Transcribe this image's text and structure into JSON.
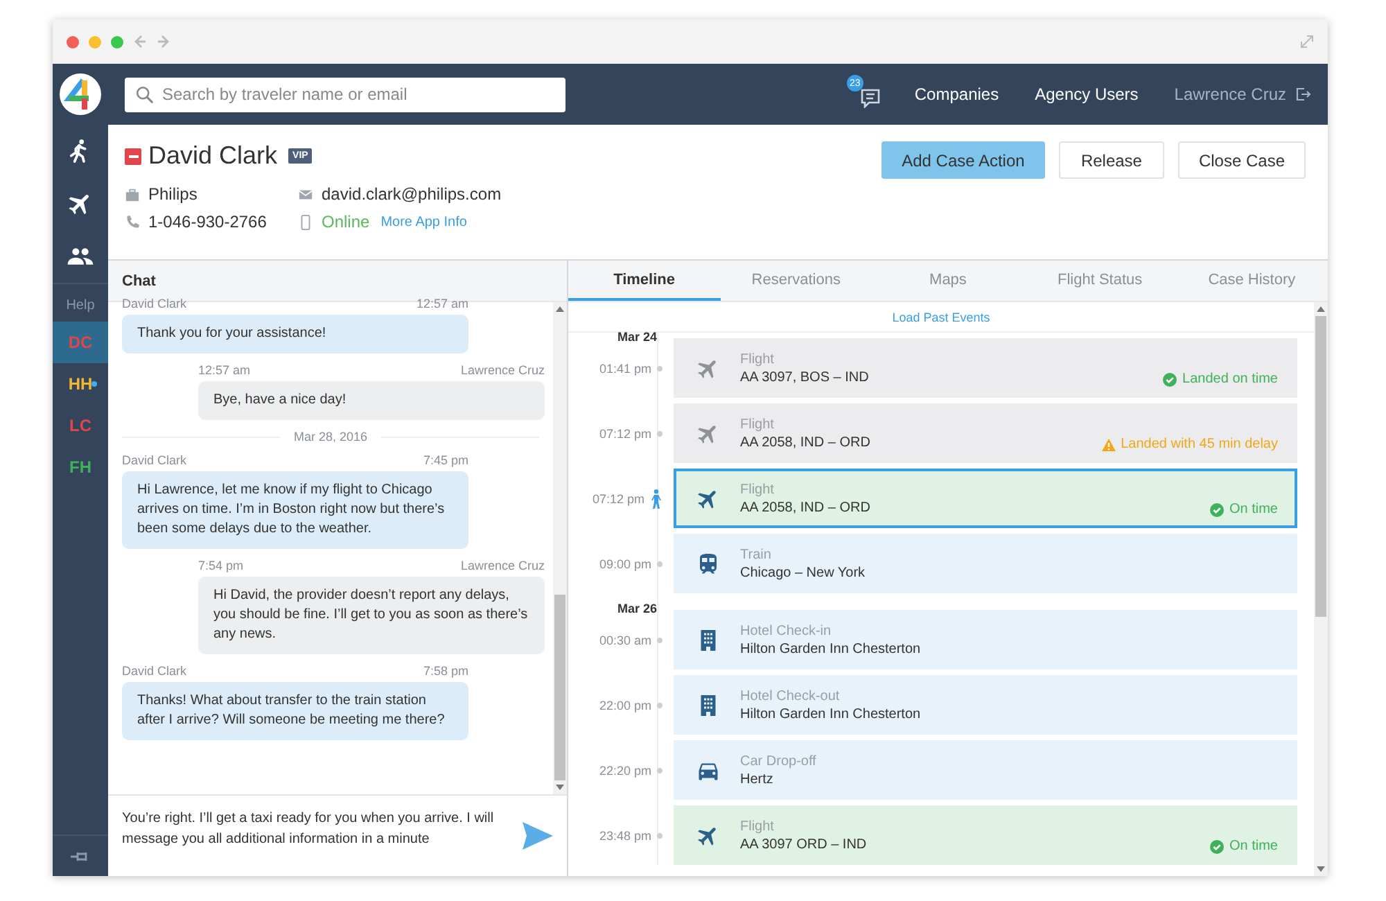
{
  "nav": {
    "search": {
      "placeholder": "Search by traveler name or email"
    },
    "messages_badge": "23",
    "links": [
      "Companies",
      "Agency Users"
    ],
    "user": "Lawrence Cruz"
  },
  "sidebar": {
    "help": "Help",
    "conversations": [
      {
        "initials": "DC",
        "color": "#e0474c",
        "selected": true,
        "unread": false
      },
      {
        "initials": "HH",
        "color": "#f2b632",
        "selected": false,
        "unread": true
      },
      {
        "initials": "LC",
        "color": "#e0474c",
        "selected": false,
        "unread": false
      },
      {
        "initials": "FH",
        "color": "#3fb15b",
        "selected": false,
        "unread": false
      }
    ]
  },
  "traveler": {
    "name": "David Clark",
    "badge": "VIP",
    "company": "Philips",
    "phone": "1-046-930-2766",
    "email": "david.clark@philips.com",
    "app_status": "Online",
    "app_link": "More App Info"
  },
  "actions": [
    {
      "label": "Add Case Action",
      "kind": "primary"
    },
    {
      "label": "Release",
      "kind": "plain"
    },
    {
      "label": "Close Case",
      "kind": "plain"
    }
  ],
  "chat": {
    "title": "Chat",
    "messages": [
      {
        "kind": "traveler",
        "sender": "David Clark",
        "time": "12:57 am",
        "text": "Thank you for your assistance!"
      },
      {
        "kind": "agent",
        "sender": "Lawrence Cruz",
        "time": "12:57 am",
        "text": "Bye, have a nice day!"
      },
      {
        "kind": "date",
        "text": "Mar 28, 2016"
      },
      {
        "kind": "traveler",
        "sender": "David Clark",
        "time": "7:45 pm",
        "text": "Hi Lawrence, let me know if my flight to Chicago arrives on time. I’m in Boston right now but there’s been some delays due to the weather."
      },
      {
        "kind": "agent",
        "sender": "Lawrence Cruz",
        "time": "7:54 pm",
        "text": "Hi David, the provider doesn’t report any delays, you should be fine. I’ll get to you as soon as there’s any news."
      },
      {
        "kind": "traveler",
        "sender": "David Clark",
        "time": "7:58 pm",
        "text": "Thanks! What about transfer to the train station after I arrive? Will someone be meeting me there?"
      }
    ],
    "compose": "You’re right. I’ll get a taxi ready for you when you arrive. I will message you all additional information in a minute"
  },
  "tabs": [
    {
      "label": "Timeline",
      "selected": true
    },
    {
      "label": "Reservations",
      "selected": false
    },
    {
      "label": "Maps",
      "selected": false
    },
    {
      "label": "Flight Status",
      "selected": false
    },
    {
      "label": "Case History",
      "selected": false
    }
  ],
  "timeline": {
    "load_link": "Load Past Events",
    "days": [
      {
        "date": "Mar 24",
        "events": [
          {
            "time": "01:41 pm",
            "kind": "flight",
            "color": "#ececee",
            "current": false,
            "selected": false,
            "category": "Flight",
            "detail": "AA 3097, BOS – IND",
            "status": {
              "kind": "ok",
              "text": "Landed on time"
            }
          },
          {
            "time": "07:12 pm",
            "kind": "flight",
            "color": "#ececee",
            "current": false,
            "selected": false,
            "category": "Flight",
            "detail": "AA 2058, IND – ORD",
            "status": {
              "kind": "warn",
              "text": "Landed with 45 min delay"
            }
          },
          {
            "time": "07:12 pm",
            "kind": "flight",
            "color": "#dff2e4",
            "current": true,
            "selected": true,
            "category": "Flight",
            "detail": "AA 2058, IND – ORD",
            "status": {
              "kind": "ok",
              "text": "On time"
            }
          },
          {
            "time": "09:00 pm",
            "kind": "train",
            "color": "#e8f2fa",
            "current": false,
            "selected": false,
            "category": "Train",
            "detail": "Chicago – New York"
          }
        ]
      },
      {
        "date": "Mar 26",
        "events": [
          {
            "time": "00:30 am",
            "kind": "hotel",
            "color": "#e8f2fa",
            "current": false,
            "selected": false,
            "category": "Hotel Check-in",
            "detail": "Hilton Garden Inn Chesterton"
          },
          {
            "time": "22:00 pm",
            "kind": "hotel",
            "color": "#e8f2fa",
            "current": false,
            "selected": false,
            "category": "Hotel Check-out",
            "detail": "Hilton Garden Inn Chesterton"
          },
          {
            "time": "22:20 pm",
            "kind": "car",
            "color": "#e8f2fa",
            "current": false,
            "selected": false,
            "category": "Car Drop-off",
            "detail": "Hertz"
          },
          {
            "time": "23:48 pm",
            "kind": "flight",
            "color": "#dff2e4",
            "current": false,
            "selected": false,
            "category": "Flight",
            "detail": "AA 3097 ORD – IND",
            "status": {
              "kind": "ok",
              "text": "On time"
            }
          }
        ]
      }
    ]
  }
}
